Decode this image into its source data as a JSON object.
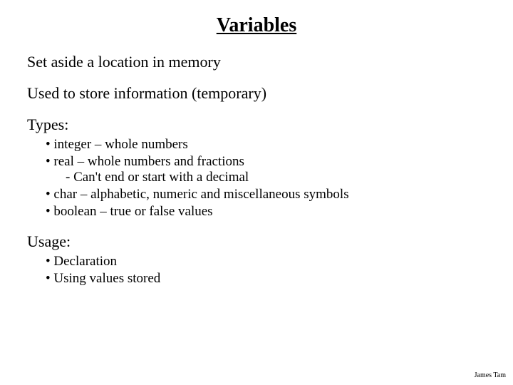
{
  "title": "Variables",
  "lines": {
    "l1": "Set aside a location in memory",
    "l2": "Used to store information (temporary)"
  },
  "types": {
    "heading": "Types:",
    "items": [
      "integer – whole numbers",
      "real – whole numbers and fractions",
      "char – alphabetic, numeric and miscellaneous symbols",
      "boolean – true or false values"
    ],
    "real_sub": "Can't end or start with a decimal"
  },
  "usage": {
    "heading": "Usage:",
    "items": [
      "Declaration",
      "Using values stored"
    ]
  },
  "footer": "James Tam"
}
